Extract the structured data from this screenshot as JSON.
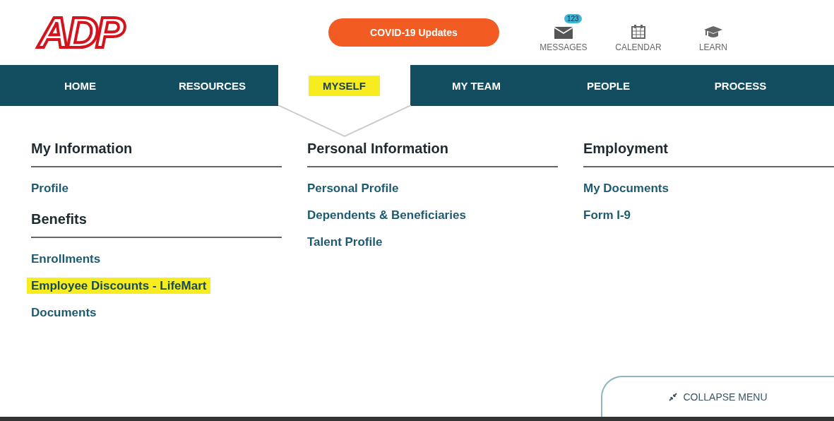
{
  "logo": {
    "text": "ADP"
  },
  "covid_button": {
    "label": "COVID-19 Updates"
  },
  "header_actions": [
    {
      "kind": "messages",
      "label": "MESSAGES",
      "badge": "123"
    },
    {
      "kind": "calendar",
      "label": "CALENDAR"
    },
    {
      "kind": "learn",
      "label": "LEARN"
    }
  ],
  "nav": {
    "tabs": [
      {
        "label": "HOME",
        "selected": false,
        "highlighted": false
      },
      {
        "label": "RESOURCES",
        "selected": false,
        "highlighted": false
      },
      {
        "label": "MYSELF",
        "selected": true,
        "highlighted": true
      },
      {
        "label": "MY TEAM",
        "selected": false,
        "highlighted": false
      },
      {
        "label": "PEOPLE",
        "selected": false,
        "highlighted": false
      },
      {
        "label": "PROCESS",
        "selected": false,
        "highlighted": false
      }
    ]
  },
  "menu": {
    "columns": [
      {
        "sections": [
          {
            "heading": "My Information",
            "links": [
              {
                "label": "Profile",
                "highlighted": false
              }
            ]
          },
          {
            "heading": "Benefits",
            "links": [
              {
                "label": "Enrollments",
                "highlighted": false
              },
              {
                "label": "Employee Discounts - LifeMart",
                "highlighted": true
              },
              {
                "label": "Documents",
                "highlighted": false
              }
            ]
          }
        ]
      },
      {
        "sections": [
          {
            "heading": "Personal Information",
            "links": [
              {
                "label": "Personal Profile",
                "highlighted": false
              },
              {
                "label": "Dependents & Beneficiaries",
                "highlighted": false
              },
              {
                "label": "Talent Profile",
                "highlighted": false
              }
            ]
          }
        ]
      },
      {
        "sections": [
          {
            "heading": "Employment",
            "links": [
              {
                "label": "My Documents",
                "highlighted": false
              },
              {
                "label": "Form I-9",
                "highlighted": false
              }
            ]
          }
        ]
      }
    ]
  },
  "collapse_button": {
    "label": "COLLAPSE MENU"
  }
}
